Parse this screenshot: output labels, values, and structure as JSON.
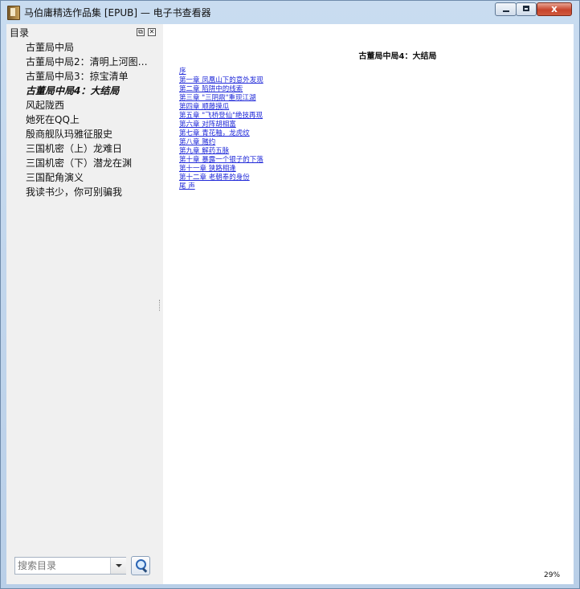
{
  "window": {
    "title": "马伯庸精选作品集 [EPUB] — 电子书查看器",
    "close_glyph": "x"
  },
  "sidebar": {
    "header": "目录",
    "float_glyph": "⧉",
    "close_glyph": "✕",
    "toc": [
      "古董局中局",
      "古董局中局2：清明上河图…",
      "古董局中局3：掠宝清单",
      "古董局中局4：大结局",
      "风起陇西",
      "她死在QQ上",
      "殷商舰队玛雅征服史",
      "三国机密（上）龙难日",
      "三国机密（下）潜龙在渊",
      "三国配角演义",
      "我读书少，你可别骗我"
    ],
    "current_index": 3,
    "search_placeholder": "搜索目录"
  },
  "content": {
    "book_title": "古董局中局4：大结局",
    "chapters": [
      "序",
      "第一章 凤凰山下的意外发现",
      "第二章 陷阱中的线索",
      "第三章 \"三阴鼎\"重现江湖",
      "第四章 顺藤摸瓜",
      "第五章 \"飞桥登仙\"绝技再现",
      "第六章 对阵胡相富",
      "第七章 青花釉，龙虎纹",
      "第八章 赌约",
      "第九章 解药五脉",
      "第十章 暴露一个银子的下落",
      "第十一章 狭路相逢",
      "第十二章 老朝奉的身份",
      "尾 声"
    ],
    "zoom": "29%"
  }
}
